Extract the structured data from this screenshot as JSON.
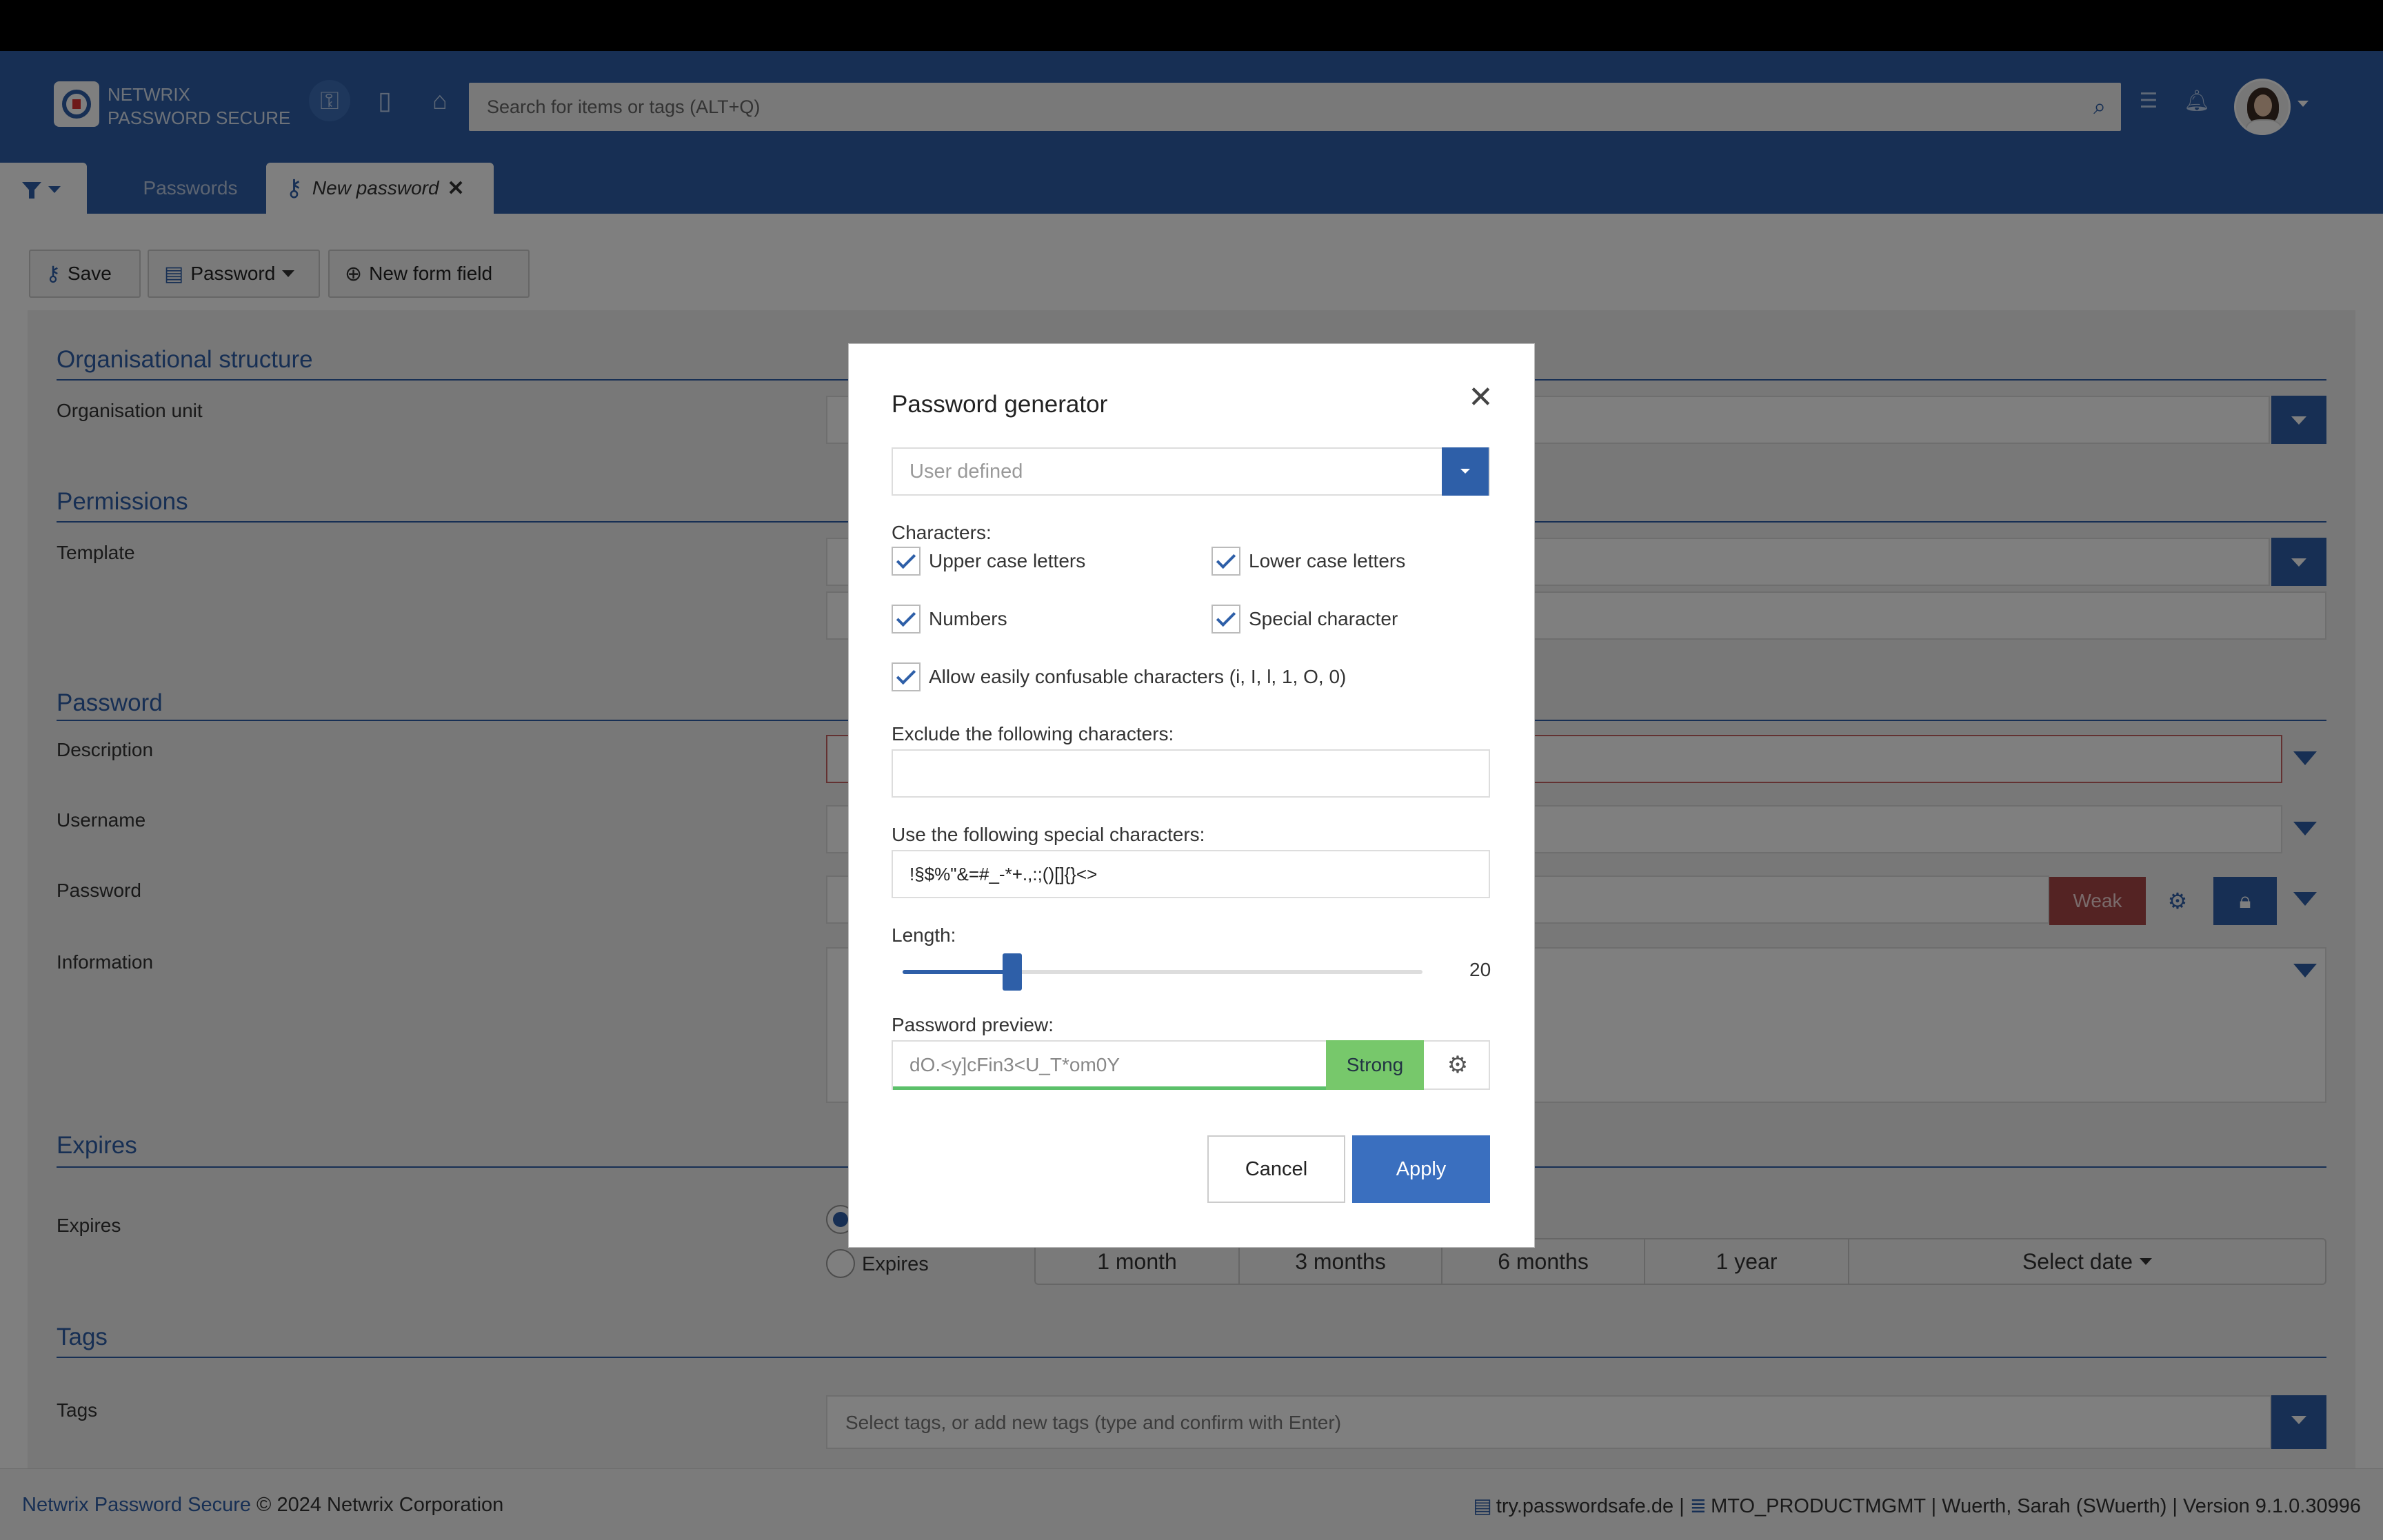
{
  "app": {
    "brand_line1": "NETWRIX",
    "brand_line2": "PASSWORD SECURE",
    "search_placeholder": "Search for items or tags (ALT+Q)",
    "header_icons": [
      "key-icon",
      "document-icon",
      "tag-icon",
      "search-icon",
      "checklist-icon",
      "bell-icon"
    ]
  },
  "tabs": {
    "passwords": "Passwords",
    "new_password": "New password",
    "close": "✕"
  },
  "toolbar": {
    "save": "Save",
    "password": "Password",
    "new_form_field": "New form field"
  },
  "form": {
    "sections": {
      "org": "Organisational structure",
      "permissions": "Permissions",
      "password": "Password",
      "expires": "Expires",
      "tags": "Tags"
    },
    "labels": {
      "org_unit": "Organisation unit",
      "template": "Template",
      "description": "Description",
      "username": "Username",
      "password": "Password",
      "information": "Information",
      "expires": "Expires",
      "tags": "Tags"
    },
    "password_strength": "Weak",
    "expires_radio": "Expires",
    "periods": [
      "1 month",
      "3 months",
      "6 months",
      "1 year",
      "Select date"
    ],
    "tags_placeholder": "Select tags, or add new tags (type and confirm with Enter)"
  },
  "modal": {
    "title": "Password generator",
    "close": "✕",
    "profile_placeholder": "User defined",
    "characters_label": "Characters:",
    "upper": "Upper case letters",
    "lower": "Lower case letters",
    "numbers": "Numbers",
    "special": "Special character",
    "confusable": "Allow easily confusable characters (i, I, l, 1, O, 0)",
    "exclude_label": "Exclude the following characters:",
    "exclude_value": "",
    "special_label": "Use the following special characters:",
    "special_value": "!§$%\"&=#_-*+.,:;()[]{}<>",
    "length_label": "Length:",
    "length_value": "20",
    "length_min": 0,
    "length_max": 100,
    "preview_label": "Password preview:",
    "preview_value": "dO.<y]cFin3<U_T*om0Y",
    "preview_strength": "Strong",
    "cancel": "Cancel",
    "apply": "Apply"
  },
  "footer": {
    "product_link": "Netwrix Password Secure",
    "copyright": " © 2024 Netwrix Corporation",
    "server": "try.passwordsafe.de",
    "sep": " | ",
    "database": "MTO_PRODUCTMGMT",
    "user": "Wuerth, Sarah (SWuerth)",
    "version": "Version 9.1.0.30996"
  }
}
